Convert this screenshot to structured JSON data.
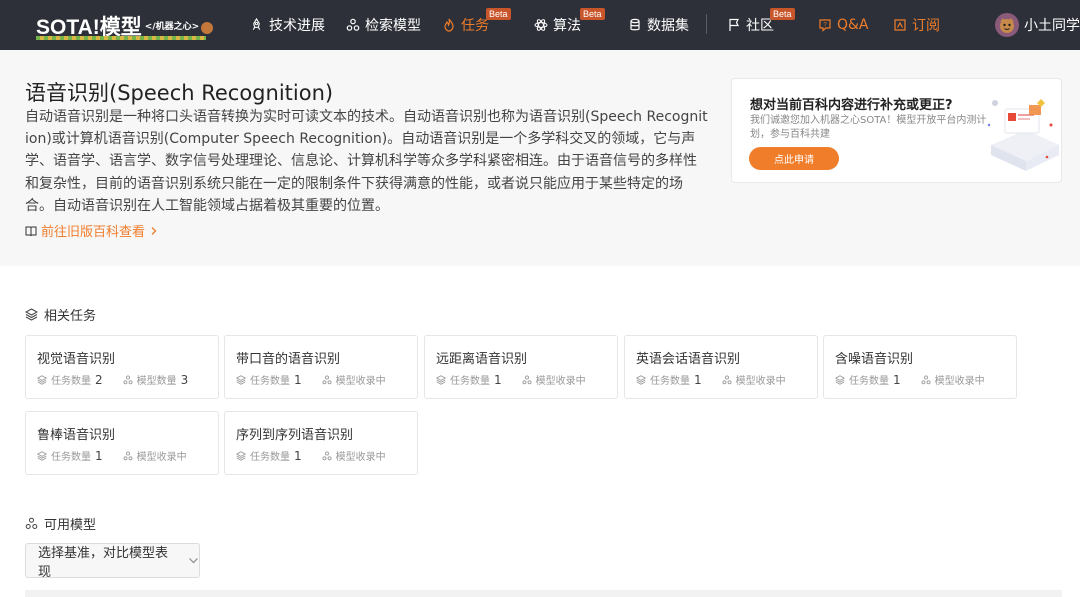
{
  "brand": {
    "logo_text": "SOTA!模型",
    "logo_tag": "</机器之心>"
  },
  "nav": {
    "items": [
      {
        "label": "技术进展",
        "icon": "rocket-icon"
      },
      {
        "label": "检索模型",
        "icon": "nodes-icon"
      },
      {
        "label": "任务",
        "icon": "flame-icon",
        "badge": "Beta"
      },
      {
        "label": "算法",
        "icon": "atom-icon",
        "badge": "Beta"
      },
      {
        "label": "数据集",
        "icon": "database-icon"
      },
      {
        "label": "社区",
        "icon": "flag-icon",
        "badge": "Beta"
      },
      {
        "label": "Q&A",
        "icon": "qa-icon"
      },
      {
        "label": "订阅",
        "icon": "subscribe-icon"
      }
    ],
    "user_name": "小土同学"
  },
  "hero": {
    "title": "语音识别(Speech Recognition)",
    "description": "自动语音识别是一种将口头语音转换为实时可读文本的技术。自动语音识别也称为语音识别(Speech Recognition)或计算机语音识别(Computer Speech Recognition)。自动语音识别是一个多学科交叉的领域，它与声学、语音学、语言学、数字信号处理理论、信息论、计算机科学等众多学科紧密相连。由于语音信号的多样性和复杂性，目前的语音识别系统只能在一定的限制条件下获得满意的性能，或者说只能应用于某些特定的场合。自动语音识别在人工智能领域占据着极其重要的位置。",
    "old_link": "前往旧版百科查看"
  },
  "promo": {
    "title": "想对当前百科内容进行补充或更正?",
    "subtitle": "我们诚邀您加入机器之心SOTA！模型开放平台内测计划，参与百科共建",
    "button": "点此申请"
  },
  "related_tasks": {
    "heading": "相关任务",
    "task_count_label": "任务数量",
    "model_count_label": "模型数量",
    "model_pending_label": "模型收录中",
    "items": [
      {
        "name": "视觉语音识别",
        "tasks": "2",
        "models": "3"
      },
      {
        "name": "带口音的语音识别",
        "tasks": "1",
        "models": null
      },
      {
        "name": "远距离语音识别",
        "tasks": "1",
        "models": null
      },
      {
        "name": "英语会话语音识别",
        "tasks": "1",
        "models": null
      },
      {
        "name": "含噪语音识别",
        "tasks": "1",
        "models": null
      },
      {
        "name": "鲁棒语音识别",
        "tasks": "1",
        "models": null
      },
      {
        "name": "序列到序列语音识别",
        "tasks": "1",
        "models": null
      }
    ]
  },
  "available_models": {
    "heading": "可用模型",
    "select_label": "选择基准，对比模型表现"
  },
  "colors": {
    "accent": "#f07d2a",
    "nav_bg": "#2d3038",
    "hero_bg": "#f7f7f8"
  }
}
